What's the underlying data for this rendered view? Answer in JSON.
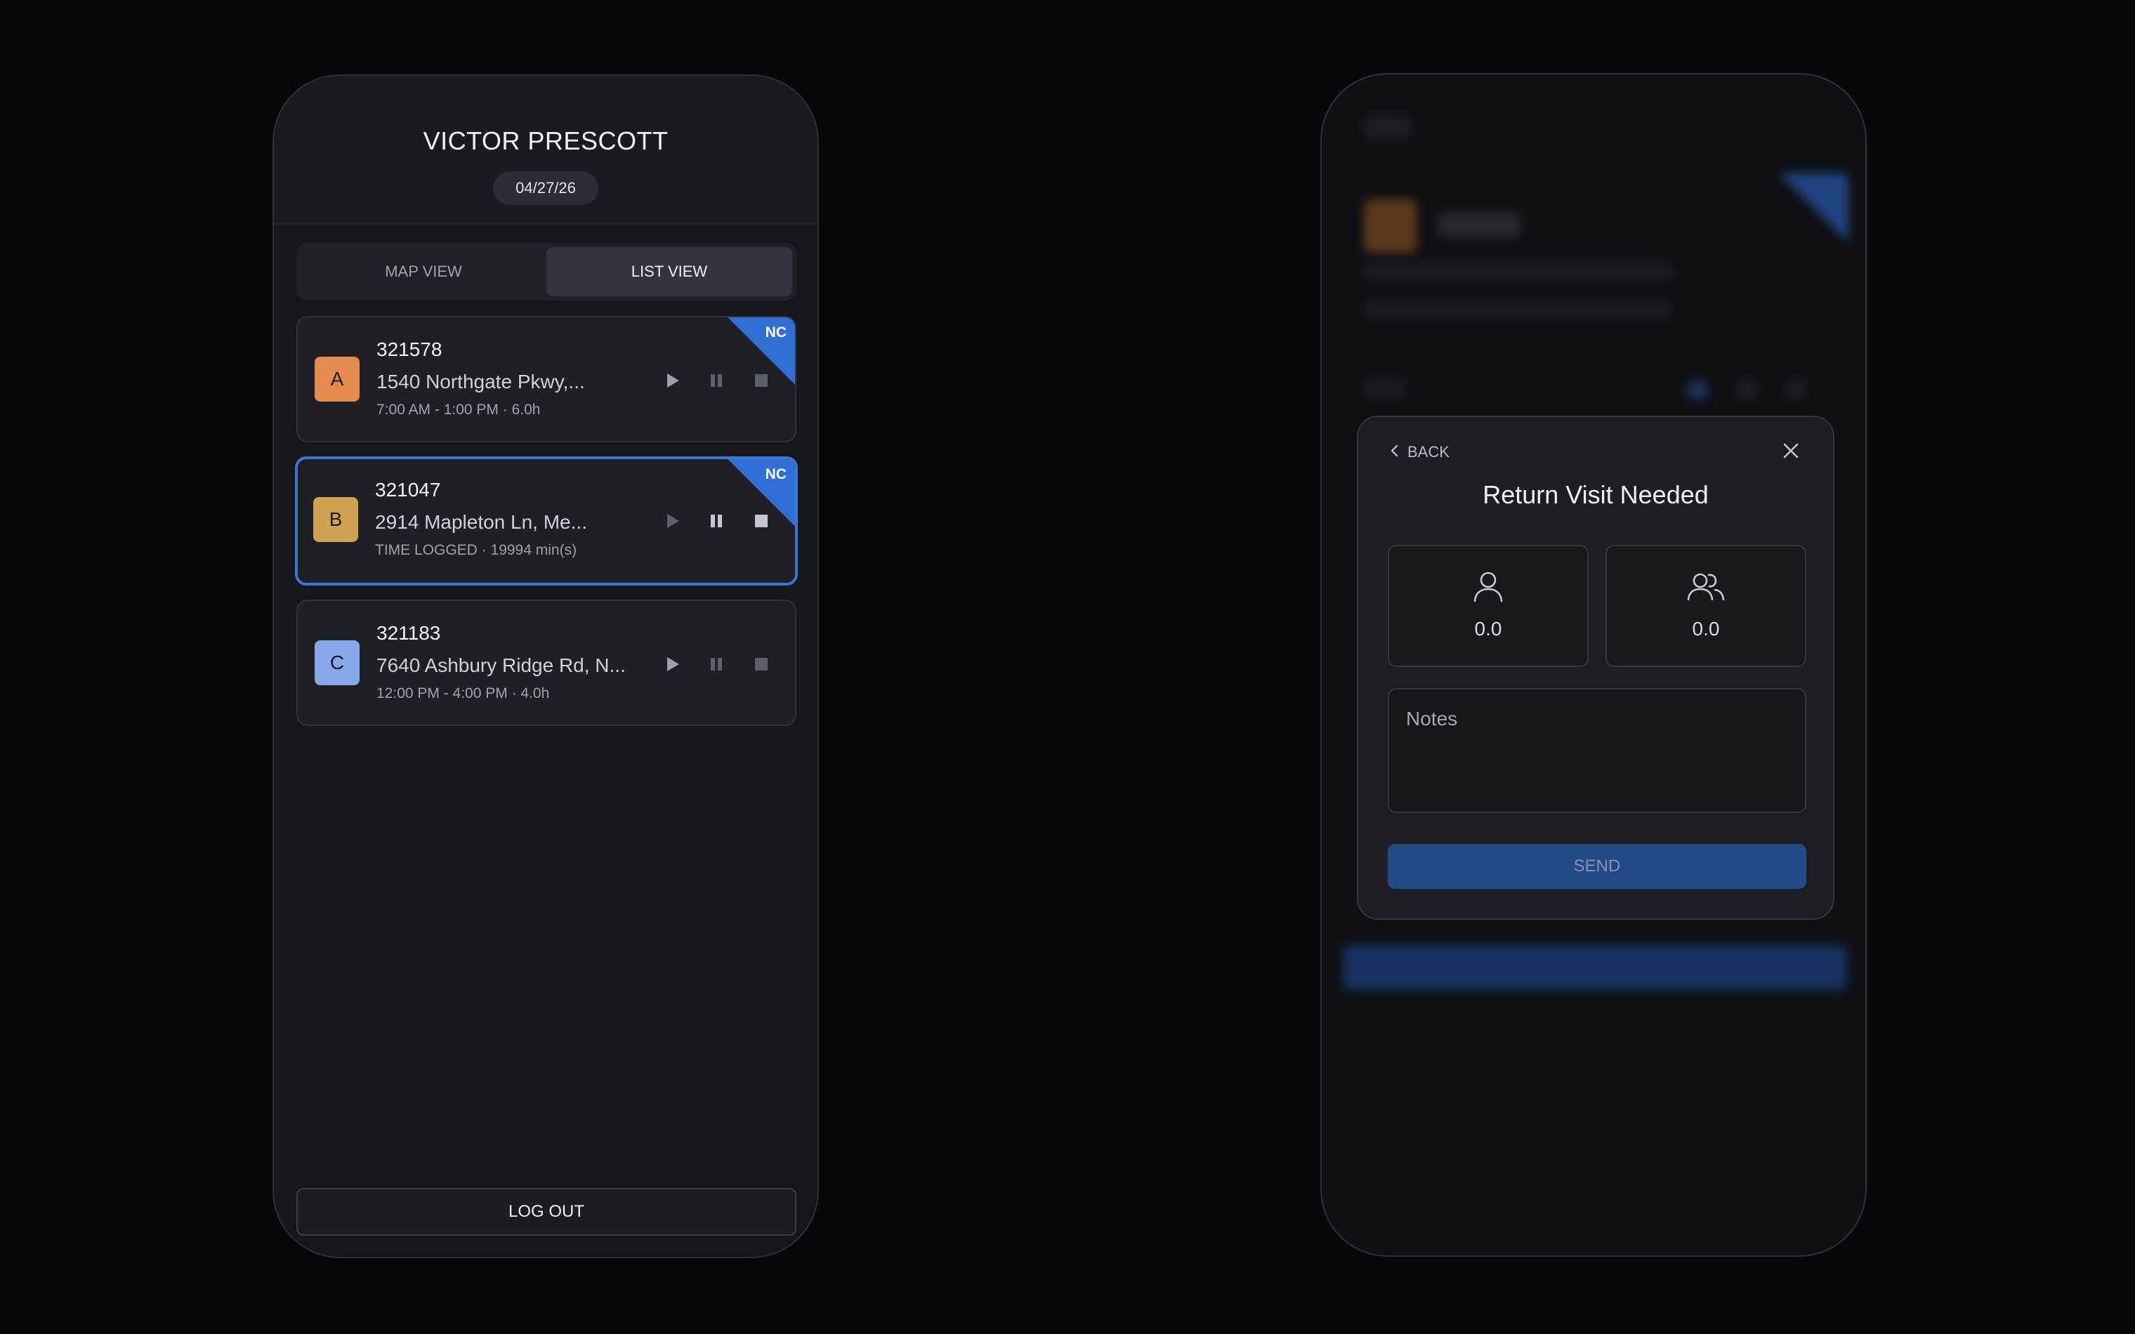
{
  "user": {
    "name": "VICTOR PRESCOTT",
    "date": "04/27/26"
  },
  "tabs": [
    {
      "label": "MAP VIEW",
      "active": false
    },
    {
      "label": "LIST VIEW",
      "active": true
    }
  ],
  "jobs": [
    {
      "letter": "A",
      "id": "321578",
      "address": "1540 Northgate Pkwy,...",
      "time": "7:00 AM - 1:00 PM · 6.0h",
      "badge": "NC",
      "color": "#e48b4e",
      "selected": false
    },
    {
      "letter": "B",
      "id": "321047",
      "address": "2914 Mapleton Ln, Me...",
      "time": "TIME LOGGED · 19994 min(s)",
      "badge": "NC",
      "color": "#cfa352",
      "selected": true
    },
    {
      "letter": "C",
      "id": "321183",
      "address": "7640 Ashbury Ridge Rd, N...",
      "time": "12:00 PM - 4:00 PM · 4.0h",
      "badge": "",
      "color": "#86a7e8",
      "selected": false
    }
  ],
  "logout_label": "LOG OUT",
  "modal": {
    "back_label": "BACK",
    "title": "Return Visit Needed",
    "single_value": "0.0",
    "group_value": "0.0",
    "notes_placeholder": "Notes",
    "send_label": "SEND"
  },
  "icons": {
    "play": "play-icon",
    "pause": "pause-icon",
    "stop": "stop-icon",
    "back": "chevron-left-icon",
    "close": "close-icon",
    "single": "user-icon",
    "group": "users-icon"
  },
  "colors": {
    "accent": "#3a76d8",
    "badge": "#2f6fd6",
    "send": "#244a85"
  }
}
